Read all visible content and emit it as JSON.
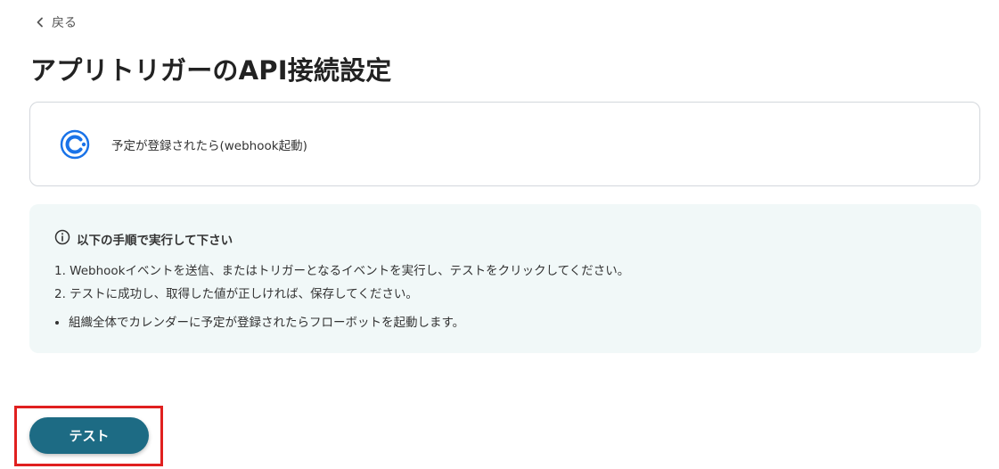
{
  "nav": {
    "back_label": "戻る"
  },
  "page": {
    "title": "アプリトリガーのAPI接続設定"
  },
  "trigger": {
    "icon": "calendly-icon",
    "label": "予定が登録されたら(webhook起動)"
  },
  "instructions": {
    "heading": "以下の手順で実行して下さい",
    "steps": [
      "1. Webhookイベントを送信、またはトリガーとなるイベントを実行し、テストをクリックしてください。",
      "2. テストに成功し、取得した値が正しければ、保存してください。"
    ],
    "notes": [
      "組織全体でカレンダーに予定が登録されたらフローボットを起動します。"
    ]
  },
  "actions": {
    "test_label": "テスト"
  },
  "colors": {
    "primary_button": "#1d6b84",
    "instructions_bg": "#f1f8f8",
    "highlight": "#e0201f",
    "app_icon": "#1a73e8"
  }
}
